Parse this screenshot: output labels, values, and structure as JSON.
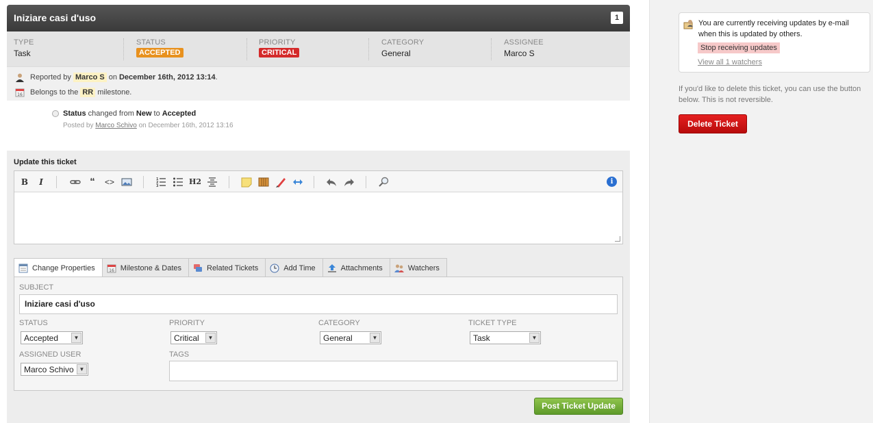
{
  "ticket": {
    "title": "Iniziare casi d'uso",
    "number": "1"
  },
  "properties": [
    {
      "label": "TYPE",
      "value": "Task"
    },
    {
      "label": "STATUS",
      "value": "ACCEPTED"
    },
    {
      "label": "PRIORITY",
      "value": "CRITICAL"
    },
    {
      "label": "CATEGORY",
      "value": "General"
    },
    {
      "label": "ASSIGNEE",
      "value": "Marco S"
    }
  ],
  "meta": {
    "reported_prefix": "Reported by",
    "reporter": "Marco S",
    "on_word": "on",
    "reported_date": "December 16th, 2012 13:14",
    "reported_suffix": ".",
    "belongs_prefix": "Belongs to the",
    "milestone": "RR",
    "belongs_suffix": "milestone."
  },
  "history": {
    "field": "Status",
    "changed_from": "changed from",
    "old_value": "New",
    "to_word": "to",
    "new_value": "Accepted",
    "posted_by": "Posted by",
    "author": "Marco Schivo",
    "posted_on": "on December 16th, 2012 13:16"
  },
  "update": {
    "heading": "Update this ticket",
    "toolbar": {
      "bold": "B",
      "italic": "I",
      "quote": "“",
      "code": "<>",
      "h2": "H2",
      "info": "i"
    },
    "tabs": [
      {
        "label": "Change Properties",
        "icon": "properties-icon"
      },
      {
        "label": "Milestone & Dates",
        "icon": "calendar-icon"
      },
      {
        "label": "Related Tickets",
        "icon": "tickets-icon"
      },
      {
        "label": "Add Time",
        "icon": "clock-icon"
      },
      {
        "label": "Attachments",
        "icon": "upload-icon"
      },
      {
        "label": "Watchers",
        "icon": "users-icon"
      }
    ],
    "fields": {
      "subject_label": "SUBJECT",
      "subject_value": "Iniziare casi d'uso",
      "status_label": "STATUS",
      "status_value": "Accepted",
      "priority_label": "PRIORITY",
      "priority_value": "Critical",
      "category_label": "CATEGORY",
      "category_value": "General",
      "type_label": "TICKET TYPE",
      "type_value": "Task",
      "assigned_label": "ASSIGNED USER",
      "assigned_value": "Marco Schivo",
      "tags_label": "TAGS",
      "tags_value": ""
    },
    "post_button": "Post Ticket Update"
  },
  "sidebar": {
    "watch_message": "You are currently receiving updates by e-mail when this is updated by others.",
    "stop_button": "Stop receiving updates",
    "view_all": "View all 1 watchers",
    "delete_note": "If you'd like to delete this ticket, you can use the button below. This is not reversible.",
    "delete_button": "Delete Ticket"
  },
  "colors": {
    "accepted": "#e8911e",
    "critical": "#d42a2a",
    "post_green": "#6aa733",
    "delete_red": "#cc1111"
  }
}
